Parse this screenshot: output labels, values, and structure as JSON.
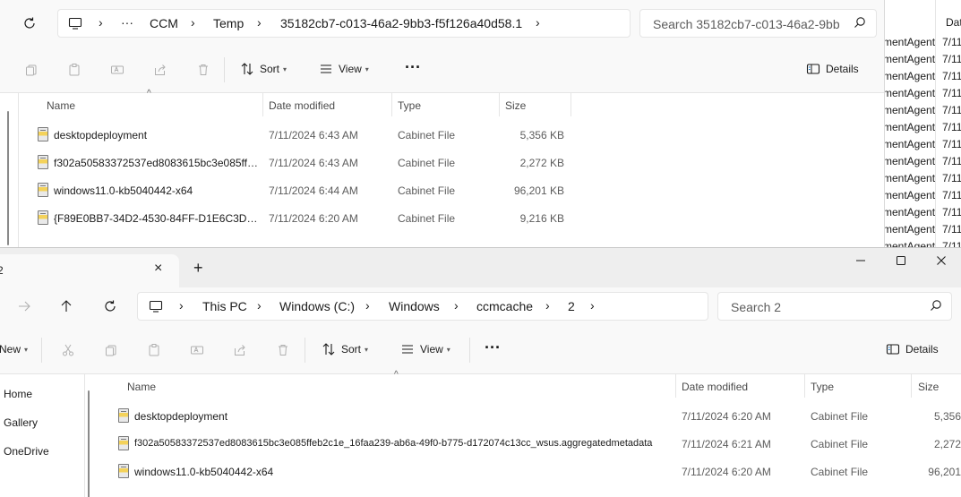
{
  "back": {
    "breadcrumb": [
      {
        "label": "CCM"
      },
      {
        "label": "Temp"
      },
      {
        "label": "35182cb7-c013-46a2-9bb3-f5f126a40d58.1"
      }
    ],
    "ellipsis": "···",
    "search_placeholder": "Search 35182cb7-c013-46a2-9bb",
    "toolbar": {
      "sort_label": "Sort",
      "view_label": "View",
      "more_label": "···",
      "details_label": "Details"
    },
    "columns": {
      "name": "Name",
      "date": "Date modified",
      "type": "Type",
      "size": "Size"
    },
    "rows": [
      {
        "name": "desktopdeployment",
        "date": "7/11/2024 6:43 AM",
        "type": "Cabinet File",
        "size": "5,356 KB"
      },
      {
        "name": "f302a50583372537ed8083615bc3e085ffeb...",
        "date": "7/11/2024 6:43 AM",
        "type": "Cabinet File",
        "size": "2,272 KB"
      },
      {
        "name": "windows11.0-kb5040442-x64",
        "date": "7/11/2024 6:44 AM",
        "type": "Cabinet File",
        "size": "96,201 KB"
      },
      {
        "name": "{F89E0BB7-34D2-4530-84FF-D1E6C3DD72...",
        "date": "7/11/2024 6:20 AM",
        "type": "Cabinet File",
        "size": "9,216 KB"
      }
    ]
  },
  "strip": {
    "header": "Dat",
    "rows": [
      {
        "a": "mentAgent",
        "b": "7/11"
      },
      {
        "a": "mentAgent",
        "b": "7/11"
      },
      {
        "a": "mentAgent",
        "b": "7/11"
      },
      {
        "a": "mentAgent",
        "b": "7/11"
      },
      {
        "a": "mentAgent",
        "b": "7/11"
      },
      {
        "a": "mentAgent",
        "b": "7/11"
      },
      {
        "a": "mentAgent",
        "b": "7/11"
      },
      {
        "a": "mentAgent",
        "b": "7/11"
      },
      {
        "a": "mentAgent",
        "b": "7/11"
      },
      {
        "a": "mentAgent",
        "b": "7/11"
      },
      {
        "a": "mentAgent",
        "b": "7/11"
      },
      {
        "a": "mentAgent",
        "b": "7/11"
      },
      {
        "a": "mentAgent",
        "b": "7/11"
      }
    ]
  },
  "front": {
    "tab_title": "2",
    "new_tab": "+",
    "breadcrumb": [
      {
        "label": "This PC"
      },
      {
        "label": "Windows (C:)"
      },
      {
        "label": "Windows"
      },
      {
        "label": "ccmcache"
      },
      {
        "label": "2"
      }
    ],
    "search_placeholder": "Search 2",
    "toolbar": {
      "new_label": "New",
      "sort_label": "Sort",
      "view_label": "View",
      "more_label": "···",
      "details_label": "Details"
    },
    "nav": [
      {
        "label": "Home"
      },
      {
        "label": "Gallery"
      },
      {
        "label": "OneDrive"
      }
    ],
    "columns": {
      "name": "Name",
      "date": "Date modified",
      "type": "Type",
      "size": "Size"
    },
    "rows": [
      {
        "name": "desktopdeployment",
        "date": "7/11/2024 6:20 AM",
        "type": "Cabinet File",
        "size": "5,356"
      },
      {
        "name": "f302a50583372537ed8083615bc3e085ffeb2c1e_16faa239-ab6a-49f0-b775-d172074c13cc_wsus.aggregatedmetadata",
        "date": "7/11/2024 6:21 AM",
        "type": "Cabinet File",
        "size": "2,272"
      },
      {
        "name": "windows11.0-kb5040442-x64",
        "date": "7/11/2024 6:20 AM",
        "type": "Cabinet File",
        "size": "96,201"
      }
    ]
  }
}
